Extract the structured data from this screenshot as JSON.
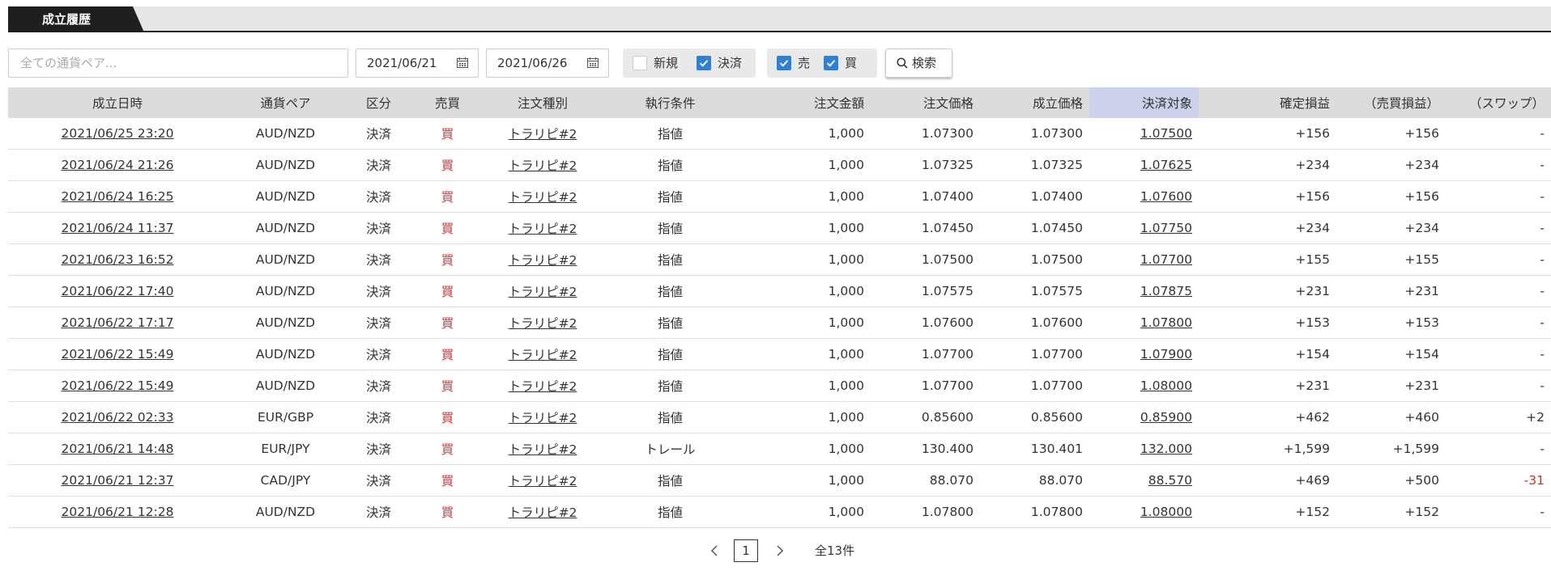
{
  "tabs": {
    "active_label": "成立履歴"
  },
  "filters": {
    "search_placeholder": "全ての通貨ペア...",
    "date_from": "2021/06/21",
    "date_to": "2021/06/26",
    "type_new_label": "新規",
    "type_new_checked": false,
    "type_close_label": "決済",
    "type_close_checked": true,
    "side_sell_label": "売",
    "side_sell_checked": true,
    "side_buy_label": "買",
    "side_buy_checked": true,
    "search_button_label": "検索"
  },
  "table": {
    "headers": [
      "成立日時",
      "通貨ペア",
      "区分",
      "売買",
      "注文種別",
      "執行条件",
      "注文金額",
      "注文価格",
      "成立価格",
      "決済対象",
      "確定損益",
      "（売買損益）",
      "（スワップ）"
    ],
    "rows": [
      [
        "2021/06/25 23:20",
        "AUD/NZD",
        "決済",
        "買",
        "トラリピ#2",
        "指値",
        "1,000",
        "1.07300",
        "1.07300",
        "1.07500",
        "+156",
        "+156",
        "-"
      ],
      [
        "2021/06/24 21:26",
        "AUD/NZD",
        "決済",
        "買",
        "トラリピ#2",
        "指値",
        "1,000",
        "1.07325",
        "1.07325",
        "1.07625",
        "+234",
        "+234",
        "-"
      ],
      [
        "2021/06/24 16:25",
        "AUD/NZD",
        "決済",
        "買",
        "トラリピ#2",
        "指値",
        "1,000",
        "1.07400",
        "1.07400",
        "1.07600",
        "+156",
        "+156",
        "-"
      ],
      [
        "2021/06/24 11:37",
        "AUD/NZD",
        "決済",
        "買",
        "トラリピ#2",
        "指値",
        "1,000",
        "1.07450",
        "1.07450",
        "1.07750",
        "+234",
        "+234",
        "-"
      ],
      [
        "2021/06/23 16:52",
        "AUD/NZD",
        "決済",
        "買",
        "トラリピ#2",
        "指値",
        "1,000",
        "1.07500",
        "1.07500",
        "1.07700",
        "+155",
        "+155",
        "-"
      ],
      [
        "2021/06/22 17:40",
        "AUD/NZD",
        "決済",
        "買",
        "トラリピ#2",
        "指値",
        "1,000",
        "1.07575",
        "1.07575",
        "1.07875",
        "+231",
        "+231",
        "-"
      ],
      [
        "2021/06/22 17:17",
        "AUD/NZD",
        "決済",
        "買",
        "トラリピ#2",
        "指値",
        "1,000",
        "1.07600",
        "1.07600",
        "1.07800",
        "+153",
        "+153",
        "-"
      ],
      [
        "2021/06/22 15:49",
        "AUD/NZD",
        "決済",
        "買",
        "トラリピ#2",
        "指値",
        "1,000",
        "1.07700",
        "1.07700",
        "1.07900",
        "+154",
        "+154",
        "-"
      ],
      [
        "2021/06/22 15:49",
        "AUD/NZD",
        "決済",
        "買",
        "トラリピ#2",
        "指値",
        "1,000",
        "1.07700",
        "1.07700",
        "1.08000",
        "+231",
        "+231",
        "-"
      ],
      [
        "2021/06/22 02:33",
        "EUR/GBP",
        "決済",
        "買",
        "トラリピ#2",
        "指値",
        "1,000",
        "0.85600",
        "0.85600",
        "0.85900",
        "+462",
        "+460",
        "+2"
      ],
      [
        "2021/06/21 14:48",
        "EUR/JPY",
        "決済",
        "買",
        "トラリピ#2",
        "トレール",
        "1,000",
        "130.400",
        "130.401",
        "132.000",
        "+1,599",
        "+1,599",
        "-"
      ],
      [
        "2021/06/21 12:37",
        "CAD/JPY",
        "決済",
        "買",
        "トラリピ#2",
        "指値",
        "1,000",
        "88.070",
        "88.070",
        "88.570",
        "+469",
        "+500",
        "-31"
      ],
      [
        "2021/06/21 12:28",
        "AUD/NZD",
        "決済",
        "買",
        "トラリピ#2",
        "指値",
        "1,000",
        "1.07800",
        "1.07800",
        "1.08000",
        "+152",
        "+152",
        "-"
      ]
    ]
  },
  "pager": {
    "current_page": "1",
    "total_label": "全13件"
  },
  "colors": {
    "buy": "#d0393d",
    "negative": "#c0392b",
    "checkbox_on": "#2f7fd6",
    "target_header": "#ccd2ec"
  }
}
